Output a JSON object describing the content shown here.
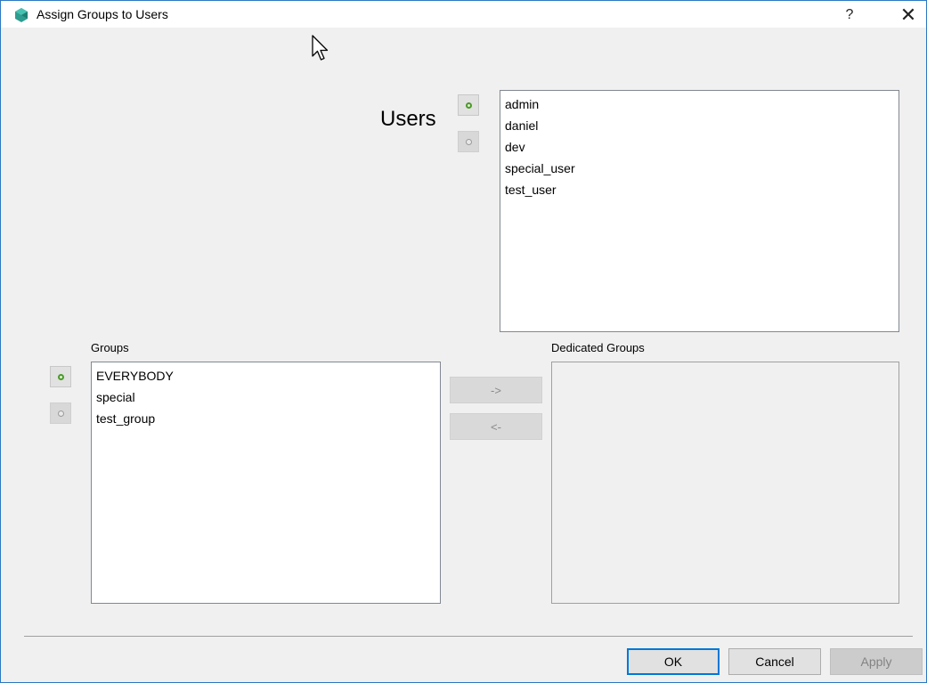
{
  "window": {
    "title": "Assign Groups to Users",
    "help_label": "?",
    "close_label": "✕"
  },
  "icons": {
    "app": "app-gem-icon",
    "add": "add-circle-icon",
    "remove": "remove-circle-icon",
    "cursor": "mouse-pointer-icon"
  },
  "colors": {
    "accent": "#0078d7",
    "add_icon": "#4a9a2a"
  },
  "users": {
    "label": "Users",
    "items": [
      "admin",
      "daniel",
      "dev",
      "special_user",
      "test_user"
    ]
  },
  "groups": {
    "label": "Groups",
    "items": [
      "EVERYBODY",
      "special",
      "test_group"
    ]
  },
  "dedicated_groups": {
    "label": "Dedicated Groups",
    "items": []
  },
  "move": {
    "right_label": "->",
    "left_label": "<-"
  },
  "footer": {
    "ok_label": "OK",
    "cancel_label": "Cancel",
    "apply_label": "Apply"
  }
}
